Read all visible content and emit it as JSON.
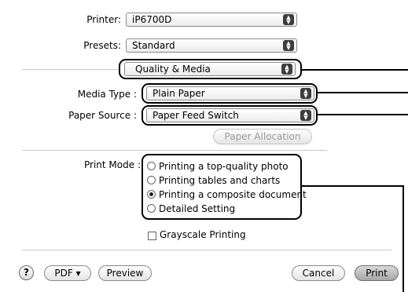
{
  "printer": {
    "label": "Printer:",
    "value": "iP6700D"
  },
  "presets": {
    "label": "Presets:",
    "value": "Standard"
  },
  "panel_selector": {
    "value": "Quality & Media"
  },
  "media_type": {
    "label": "Media Type :",
    "value": "Plain Paper"
  },
  "paper_source": {
    "label": "Paper Source :",
    "value": "Paper Feed Switch"
  },
  "paper_allocation": {
    "label": "Paper Allocation"
  },
  "print_mode": {
    "label": "Print Mode :",
    "options": [
      {
        "label": "Printing a top-quality photo",
        "checked": false
      },
      {
        "label": "Printing tables and charts",
        "checked": false
      },
      {
        "label": "Printing a composite document",
        "checked": true
      },
      {
        "label": "Detailed Setting",
        "checked": false
      }
    ]
  },
  "grayscale": {
    "label": "Grayscale Printing",
    "checked": false
  },
  "footer": {
    "help": "?",
    "pdf": "PDF ▾",
    "preview": "Preview",
    "cancel": "Cancel",
    "print": "Print"
  }
}
